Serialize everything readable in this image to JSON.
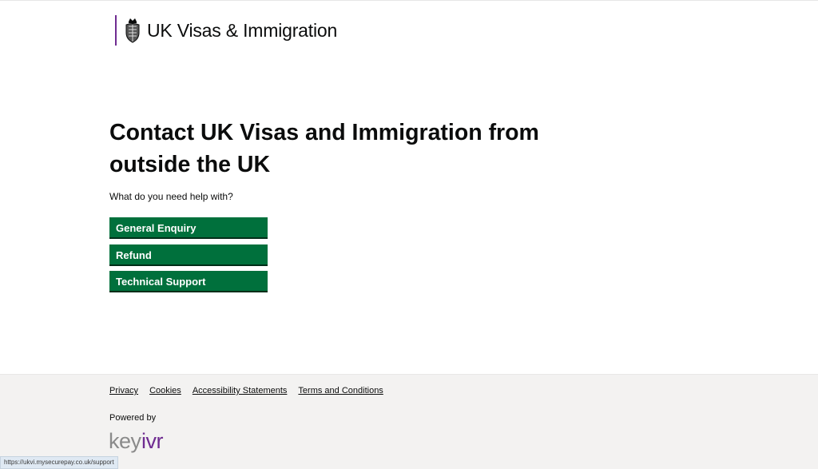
{
  "header": {
    "brand_name": "UK Visas & Immigration",
    "crest_icon": "royal-crest-icon",
    "brand_color": "#6f2c91"
  },
  "main": {
    "title": "Contact UK Visas and Immigration from outside the UK",
    "question": "What do you need help with?",
    "buttons": [
      {
        "label": "General Enquiry"
      },
      {
        "label": "Refund"
      },
      {
        "label": "Technical Support"
      }
    ],
    "button_color": "#00703c"
  },
  "footer": {
    "links": [
      {
        "label": "Privacy"
      },
      {
        "label": "Cookies"
      },
      {
        "label": "Accessibility Statements"
      },
      {
        "label": "Terms and Conditions"
      }
    ],
    "powered_by": "Powered by",
    "vendor_logo": "keyivr",
    "background": "#f3f2f1"
  },
  "status_bar": {
    "url": "https://ukvi.mysecurepay.co.uk/support"
  }
}
